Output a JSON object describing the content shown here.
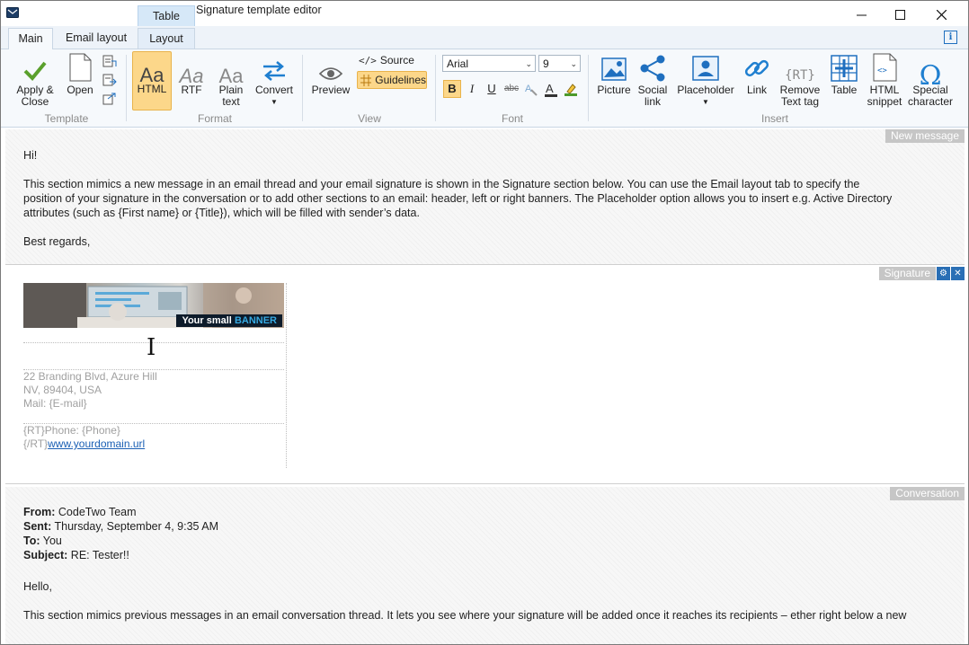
{
  "window": {
    "title": "Signature template editor",
    "contextual_tab": "Table"
  },
  "tabs": [
    {
      "label": "Main",
      "active": true
    },
    {
      "label": "Email layout",
      "active": false
    },
    {
      "label": "Layout",
      "active": false
    }
  ],
  "ribbon": {
    "template": {
      "group_label": "Template",
      "apply_label": "Apply &\nClose",
      "open_label": "Open"
    },
    "format": {
      "group_label": "Format",
      "html_label": "HTML",
      "rtf_label": "RTF",
      "plain_label": "Plain\ntext",
      "convert_label": "Convert",
      "glyph": "Aa"
    },
    "view": {
      "group_label": "View",
      "preview_label": "Preview",
      "source_label": "Source",
      "guidelines_label": "Guidelines"
    },
    "font": {
      "group_label": "Font",
      "font_name": "Arial",
      "font_size": "9",
      "bold": "B",
      "italic": "I",
      "underline": "U",
      "strike": "abc"
    },
    "insert": {
      "group_label": "Insert",
      "picture_label": "Picture",
      "social_label": "Social\nlink",
      "placeholder_label": "Placeholder",
      "link_label": "Link",
      "remove_tag_label": "Remove\nText tag",
      "table_label": "Table",
      "html_snippet_label": "HTML\nsnippet",
      "special_char_label": "Special\ncharacter",
      "rt_glyph": "{RT}"
    }
  },
  "new_message": {
    "label": "New message",
    "greeting": "Hi!",
    "line1": "This section mimics a new message in an email thread and your email signature is shown in the Signature section below. You can use the Email layout tab to specify the",
    "line2": "position of your signature in the conversation or to add other sections to an email: header, left or right banners. The Placeholder option allows you to insert e.g. Active Directory",
    "line3": "attributes (such as {First name} or {Title}), which will be filled with sender’s data.",
    "closing": "Best regards,"
  },
  "signature": {
    "label": "Signature",
    "banner_text": "Your small",
    "banner_highlight": "BANNER",
    "address1": "22 Branding Blvd, Azure Hill",
    "address2": "NV, 89404, USA",
    "mail": "Mail: {E-mail}",
    "phone": "{RT}Phone: {Phone}",
    "rt_close": "{/RT}",
    "url": "www.yourdomain.url"
  },
  "conversation": {
    "label": "Conversation",
    "from_label": "From:",
    "from_value": "CodeTwo Team",
    "sent_label": "Sent:",
    "sent_value": "Thursday, September 4, 9:35 AM",
    "to_label": "To:",
    "to_value": "You",
    "subject_label": "Subject:",
    "subject_value": "RE: Tester!!",
    "hello": "Hello,",
    "body": "This section mimics previous messages in an email conversation thread. It lets you see where your signature will be added once it reaches its recipients – ether right below a new"
  },
  "colors": {
    "accent": "#1f6fbf",
    "selected": "#fcd78a",
    "ribbon_bg": "#f6f9fc"
  }
}
